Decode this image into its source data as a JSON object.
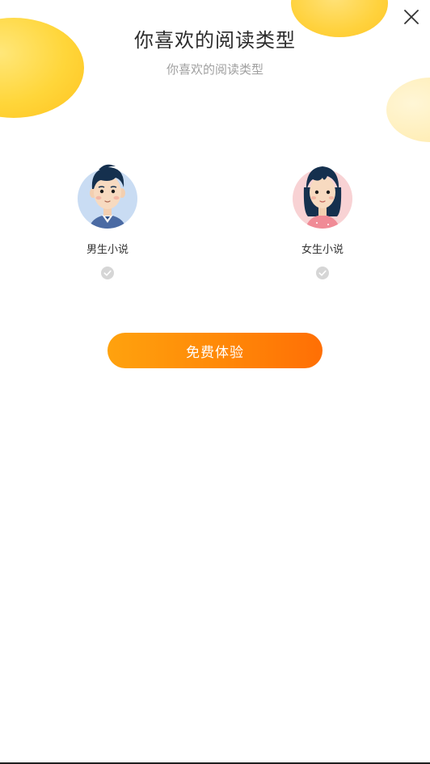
{
  "header": {
    "title": "你喜欢的阅读类型",
    "subtitle": "你喜欢的阅读类型",
    "close_icon": "close-icon"
  },
  "choices": [
    {
      "label": "男生小说",
      "avatar": "boy-avatar",
      "selected": false
    },
    {
      "label": "女生小说",
      "avatar": "girl-avatar",
      "selected": false
    }
  ],
  "cta": {
    "label": "免费体验"
  },
  "colors": {
    "accent_start": "#ffa20e",
    "accent_end": "#ff6f05",
    "blob_yellow": "#ffd63a",
    "check_grey": "#d6d6d6",
    "title_text": "#2b2b2b",
    "subtitle_text": "#a0a0a0"
  }
}
